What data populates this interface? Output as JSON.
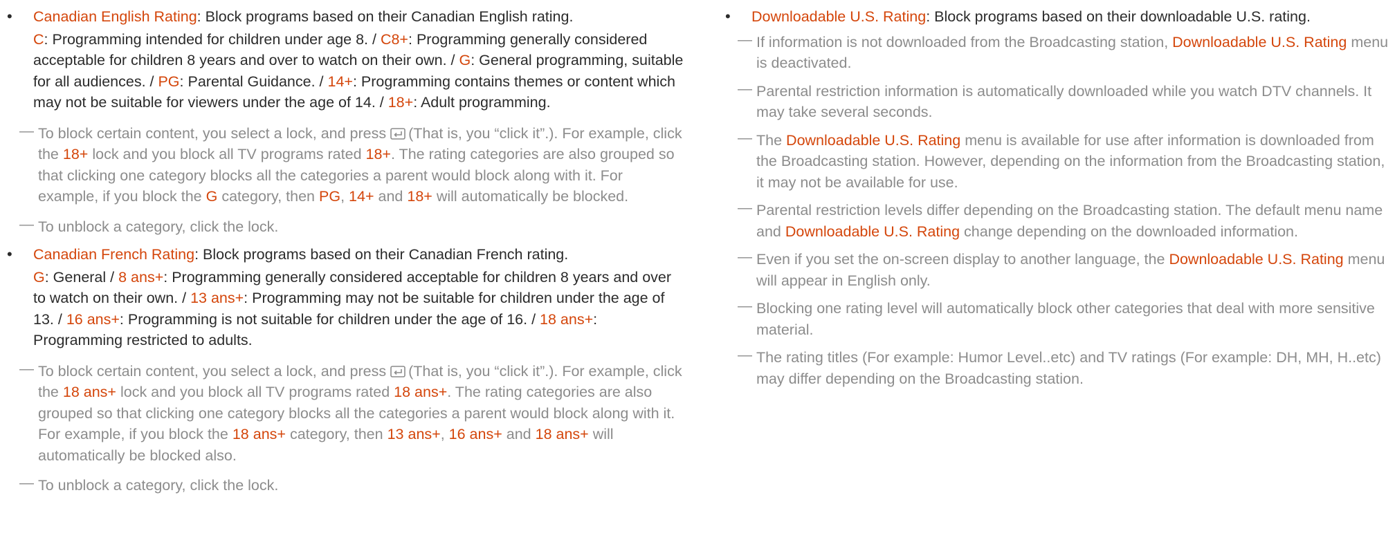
{
  "colors": {
    "highlight": "#d4460b",
    "body_text": "#2b2b2b",
    "note_text": "#8c8c8c"
  },
  "left": {
    "english": {
      "title": "Canadian English Rating",
      "desc": ": Block programs based on their Canadian English rating.",
      "r1": "C",
      "r1_desc": ": Programming intended for children under age 8. / ",
      "r2": "C8+",
      "r2_desc": ": Programming generally considered acceptable for children 8 years and over to watch on their own. / ",
      "r3": "G",
      "r3_desc": ": General programming, suitable for all audiences. / ",
      "r4": "PG",
      "r4_desc": ": Parental Guidance. / ",
      "r5": "14+",
      "r5_desc": ": Programming contains themes or content which may not be suitable for viewers under the age of 14. / ",
      "r6": "18+",
      "r6_desc": ": Adult programming."
    },
    "english_note1": {
      "a": "To block certain content, you select a lock, and press",
      "b": "(That is, you “click it”.). For example, click the",
      "c": "18+",
      "d": "lock and you block all TV programs rated",
      "e": "18+",
      "f": ". The rating categories are also grouped so that clicking one category blocks all the categories a parent would block along with it. For example, if you block the",
      "g": "G",
      "h": "category, then",
      "i": "PG",
      "j": ",",
      "k": "14+",
      "l": "and",
      "m": "18+",
      "n": "will automatically be blocked."
    },
    "english_note2": "To unblock a category, click the lock.",
    "french": {
      "title": "Canadian French Rating",
      "desc": ": Block programs based on their Canadian French rating.",
      "r1": "G",
      "r1_desc": ": General / ",
      "r2": "8 ans+",
      "r2_desc": ": Programming generally considered acceptable for children 8 years and over to watch on their own. / ",
      "r3": "13 ans+",
      "r3_desc": ": Programming may not be suitable for children under the age of 13. / ",
      "r4": "16 ans+",
      "r4_desc": ": Programming is not suitable for children under the age of 16. / ",
      "r5": "18 ans+",
      "r5_desc": ": Programming restricted to adults."
    },
    "french_note1": {
      "a": "To block certain content, you select a lock, and press",
      "b": "(That is, you “click it”.). For example, click the",
      "c": "18 ans+",
      "d": "lock and you block all TV programs rated",
      "e": "18 ans+",
      "f": ". The rating categories are also grouped so that clicking one category blocks all the categories a parent would block along with it. For example, if you block the",
      "g": "18 ans+",
      "h": "category, then",
      "i": "13 ans+",
      "j": ",",
      "k": "16 ans+",
      "l": "and",
      "m": "18 ans+",
      "n": "will automatically be blocked also."
    },
    "french_note2": "To unblock a category, click the lock."
  },
  "right": {
    "title": "Downloadable U.S. Rating",
    "desc": ": Block programs based on their downloadable U.S. rating.",
    "n1": {
      "a": "If information is not downloaded from the Broadcasting station,",
      "b": "Downloadable U.S. Rating",
      "c": "menu is deactivated."
    },
    "n2": "Parental restriction information is automatically downloaded while you watch DTV channels. It may take several seconds.",
    "n3": {
      "a": "The",
      "b": "Downloadable U.S. Rating",
      "c": "menu is available for use after information is downloaded from the Broadcasting station. However, depending on the information from the Broadcasting station, it may not be available for use."
    },
    "n4": {
      "a": "Parental restriction levels differ depending on the Broadcasting station. The default menu name and",
      "b": "Downloadable U.S. Rating",
      "c": "change depending on the downloaded information."
    },
    "n5": {
      "a": "Even if you set the on-screen display to another language, the",
      "b": "Downloadable U.S. Rating",
      "c": "menu will appear in English only."
    },
    "n6": "Blocking one rating level will automatically block other categories that deal with more sensitive material.",
    "n7": "The rating titles (For example: Humor Level..etc) and TV ratings (For example: DH, MH, H..etc) may differ depending on the Broadcasting station."
  }
}
